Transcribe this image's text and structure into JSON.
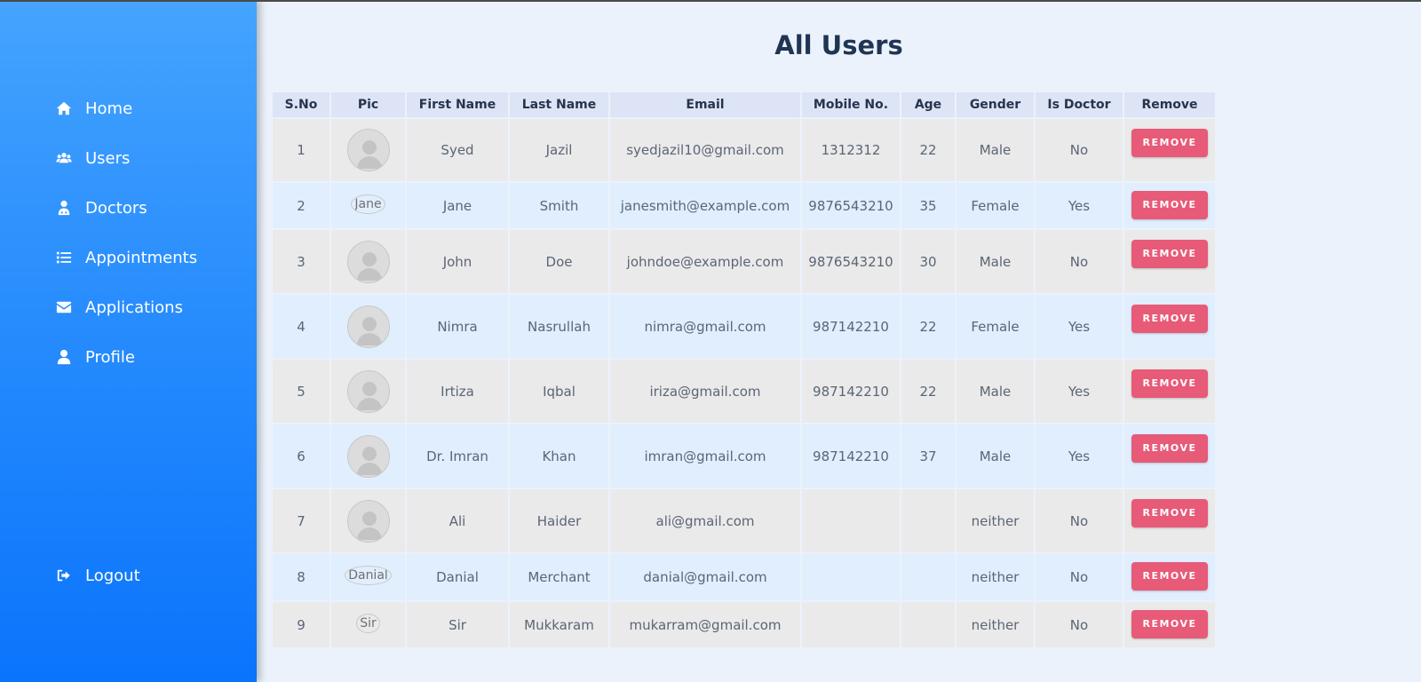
{
  "sidebar": {
    "items": [
      {
        "label": "Home",
        "icon": "home-icon"
      },
      {
        "label": "Users",
        "icon": "users-icon"
      },
      {
        "label": "Doctors",
        "icon": "doctor-icon"
      },
      {
        "label": "Appointments",
        "icon": "list-icon"
      },
      {
        "label": "Applications",
        "icon": "envelope-icon"
      },
      {
        "label": "Profile",
        "icon": "user-icon"
      }
    ],
    "logout": {
      "label": "Logout",
      "icon": "sign-out-icon"
    }
  },
  "page": {
    "title": "All Users"
  },
  "table": {
    "headers": [
      "S.No",
      "Pic",
      "First Name",
      "Last Name",
      "Email",
      "Mobile No.",
      "Age",
      "Gender",
      "Is Doctor",
      "Remove"
    ],
    "remove_label": "REMOVE",
    "rows": [
      {
        "sno": "1",
        "pic": "avatar",
        "first": "Syed",
        "last": "Jazil",
        "email": "syedjazil10@gmail.com",
        "mobile": "1312312",
        "age": "22",
        "gender": "Male",
        "doctor": "No"
      },
      {
        "sno": "2",
        "pic": "Jane",
        "first": "Jane",
        "last": "Smith",
        "email": "janesmith@example.com",
        "mobile": "9876543210",
        "age": "35",
        "gender": "Female",
        "doctor": "Yes"
      },
      {
        "sno": "3",
        "pic": "avatar",
        "first": "John",
        "last": "Doe",
        "email": "johndoe@example.com",
        "mobile": "9876543210",
        "age": "30",
        "gender": "Male",
        "doctor": "No"
      },
      {
        "sno": "4",
        "pic": "avatar",
        "first": "Nimra",
        "last": "Nasrullah",
        "email": "nimra@gmail.com",
        "mobile": "987142210",
        "age": "22",
        "gender": "Female",
        "doctor": "Yes"
      },
      {
        "sno": "5",
        "pic": "avatar",
        "first": "Irtiza",
        "last": "Iqbal",
        "email": "iriza@gmail.com",
        "mobile": "987142210",
        "age": "22",
        "gender": "Male",
        "doctor": "Yes"
      },
      {
        "sno": "6",
        "pic": "avatar",
        "first": "Dr. Imran",
        "last": "Khan",
        "email": "imran@gmail.com",
        "mobile": "987142210",
        "age": "37",
        "gender": "Male",
        "doctor": "Yes"
      },
      {
        "sno": "7",
        "pic": "avatar",
        "first": "Ali",
        "last": "Haider",
        "email": "ali@gmail.com",
        "mobile": "",
        "age": "",
        "gender": "neither",
        "doctor": "No"
      },
      {
        "sno": "8",
        "pic": "Danial",
        "first": "Danial",
        "last": "Merchant",
        "email": "danial@gmail.com",
        "mobile": "",
        "age": "",
        "gender": "neither",
        "doctor": "No"
      },
      {
        "sno": "9",
        "pic": "Sir",
        "first": "Sir",
        "last": "Mukkaram",
        "email": "mukarram@gmail.com",
        "mobile": "",
        "age": "",
        "gender": "neither",
        "doctor": "No"
      }
    ]
  },
  "colors": {
    "sidebar_top": "#45a4fe",
    "sidebar_bottom": "#0a74fc",
    "remove_button": "#e75a78",
    "title": "#1f3553"
  }
}
